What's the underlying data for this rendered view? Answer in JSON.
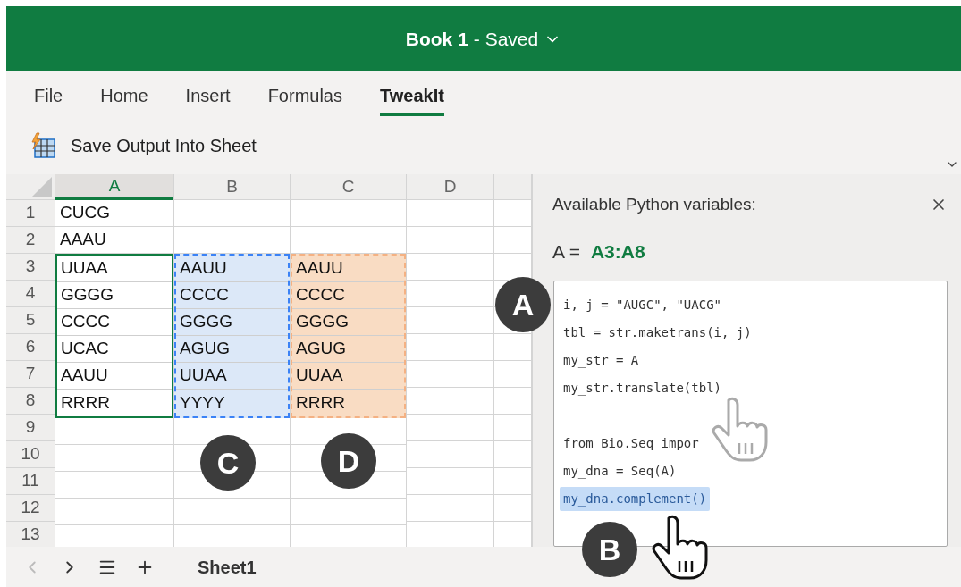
{
  "window": {
    "title": "Book 1",
    "status": "- Saved"
  },
  "tabs": [
    {
      "label": "File",
      "selected": false
    },
    {
      "label": "Home",
      "selected": false
    },
    {
      "label": "Insert",
      "selected": false
    },
    {
      "label": "Formulas",
      "selected": false
    },
    {
      "label": "TweakIt",
      "selected": true
    }
  ],
  "ribbon": {
    "button": "Save Output Into Sheet"
  },
  "sheet": {
    "row_headers": [
      "1",
      "2",
      "3",
      "4",
      "5",
      "6",
      "7",
      "8",
      "9",
      "10",
      "11",
      "12",
      "13"
    ],
    "columns": [
      {
        "label": "A",
        "selected": true,
        "cells": [
          {
            "text": "CUCG",
            "kind": "plain"
          },
          {
            "text": "AAAU",
            "kind": "plain"
          },
          {
            "text": "UUAA",
            "kind": "selected"
          },
          {
            "text": "GGGG",
            "kind": "selected"
          },
          {
            "text": "CCCC",
            "kind": "selected"
          },
          {
            "text": "UCAC",
            "kind": "selected"
          },
          {
            "text": "AAUU",
            "kind": "selected"
          },
          {
            "text": "RRRR",
            "kind": "selected"
          }
        ]
      },
      {
        "label": "B",
        "selected": false,
        "cells": [
          {
            "kind": "plain"
          },
          {
            "kind": "plain"
          },
          {
            "text": "AAUU",
            "kind": "copied"
          },
          {
            "text": "CCCC",
            "kind": "copied"
          },
          {
            "text": "GGGG",
            "kind": "copied"
          },
          {
            "text": "AGUG",
            "kind": "copied"
          },
          {
            "text": "UUAA",
            "kind": "copied"
          },
          {
            "text": "YYYY",
            "kind": "copied"
          }
        ]
      },
      {
        "label": "C",
        "selected": false,
        "cells": [
          {
            "kind": "plain"
          },
          {
            "kind": "plain"
          },
          {
            "text": "AAUU",
            "kind": "result"
          },
          {
            "text": "CCCC",
            "kind": "result"
          },
          {
            "text": "GGGG",
            "kind": "result"
          },
          {
            "text": "AGUG",
            "kind": "result"
          },
          {
            "text": "UUAA",
            "kind": "result"
          },
          {
            "text": "RRRR",
            "kind": "result"
          }
        ]
      },
      {
        "label": "D",
        "selected": false
      }
    ]
  },
  "panel": {
    "title": "Available Python variables:",
    "variable": {
      "name": "A =",
      "range": "A3:A8"
    },
    "code": [
      {
        "kind": "code",
        "text": "i, j = \"AUGC\", \"UACG\"",
        "highlighted": false
      },
      {
        "kind": "code",
        "text": "tbl = str.maketrans(i, j)",
        "highlighted": false
      },
      {
        "kind": "code",
        "text": "my_str = A",
        "highlighted": false
      },
      {
        "kind": "code",
        "text": "my_str.translate(tbl)",
        "highlighted": false
      },
      {
        "kind": "blank"
      },
      {
        "kind": "code",
        "text": "from Bio.Seq impor",
        "highlighted": false
      },
      {
        "kind": "code",
        "text": "my_dna = Seq(A)",
        "highlighted": false
      },
      {
        "kind": "code",
        "text": "my_dna.complement()",
        "highlighted": true
      }
    ]
  },
  "callouts": [
    "A",
    "B",
    "C",
    "D"
  ],
  "sheet_tabs": {
    "active": "Sheet1"
  }
}
